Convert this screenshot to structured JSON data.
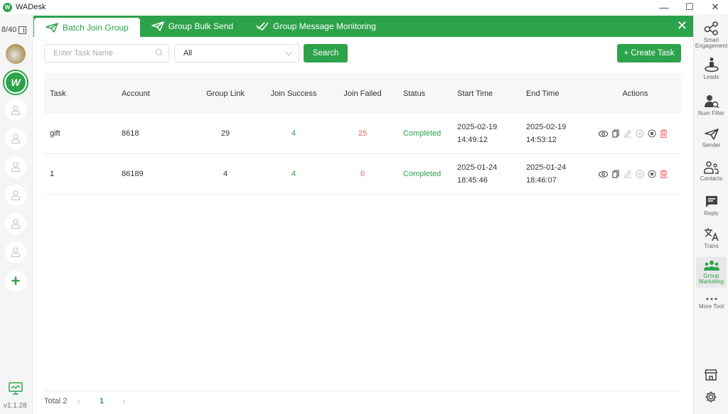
{
  "window": {
    "title": "WADesk",
    "minimize": "—",
    "maximize": "☐",
    "close": "✕"
  },
  "left_sidebar": {
    "account_count": "8/40",
    "version": "v1.1.28",
    "empty_slots": 6,
    "add_label": "+"
  },
  "tabs": [
    {
      "label": "Batch Join Group",
      "icon": "paper-plane-icon",
      "active": true
    },
    {
      "label": "Group Bulk Send",
      "icon": "paper-plane-icon",
      "active": false
    },
    {
      "label": "Group Message Monitoring",
      "icon": "double-check-icon",
      "active": false
    }
  ],
  "tab_close": "✕",
  "filters": {
    "task_name_placeholder": "Enter Task Name",
    "status_select_value": "All",
    "search_label": "Search",
    "create_task_label": "+ Create Task"
  },
  "table": {
    "columns": [
      "Task",
      "Account",
      "Group Link",
      "Join Success",
      "Join Failed",
      "Status",
      "Start Time",
      "End Time",
      "Actions"
    ],
    "rows": [
      {
        "task": "gift",
        "account": "8618",
        "group_link": "29",
        "join_success": "4",
        "join_failed": "25",
        "status": "Completed",
        "start_date": "2025-02-19",
        "start_time": "14:49:12",
        "end_date": "2025-02-19",
        "end_time": "14:53:12"
      },
      {
        "task": "1",
        "account": "86189",
        "group_link": "4",
        "join_success": "4",
        "join_failed": "0",
        "status": "Completed",
        "start_date": "2025-01-24",
        "start_time": "18:45:46",
        "end_date": "2025-01-24",
        "end_time": "18:46:07"
      }
    ],
    "row_actions": [
      "view-icon",
      "copy-icon",
      "edit-icon",
      "pause-icon",
      "stop-icon",
      "delete-icon"
    ]
  },
  "pagination": {
    "total_label": "Total 2",
    "current_page": "1",
    "prev": "‹",
    "next": "›"
  },
  "right_sidebar": {
    "items": [
      {
        "label": "Smart Engagement",
        "icon": "share-nodes-icon"
      },
      {
        "label": "Leads",
        "icon": "leads-person-icon"
      },
      {
        "label": "Num Filter",
        "icon": "user-search-icon"
      },
      {
        "label": "Sender",
        "icon": "paper-plane-icon"
      },
      {
        "label": "Contacts",
        "icon": "contacts-icon"
      },
      {
        "label": "Reply",
        "icon": "chat-icon"
      },
      {
        "label": "Trans",
        "icon": "translate-icon"
      },
      {
        "label": "Group Marketing",
        "icon": "group-icon",
        "active": true
      },
      {
        "label": "More Tool",
        "icon": "more-dots-icon"
      }
    ]
  },
  "colors": {
    "accent": "#2ca34a",
    "danger": "#f06060",
    "sidebar_bg": "#f5f5f5"
  }
}
